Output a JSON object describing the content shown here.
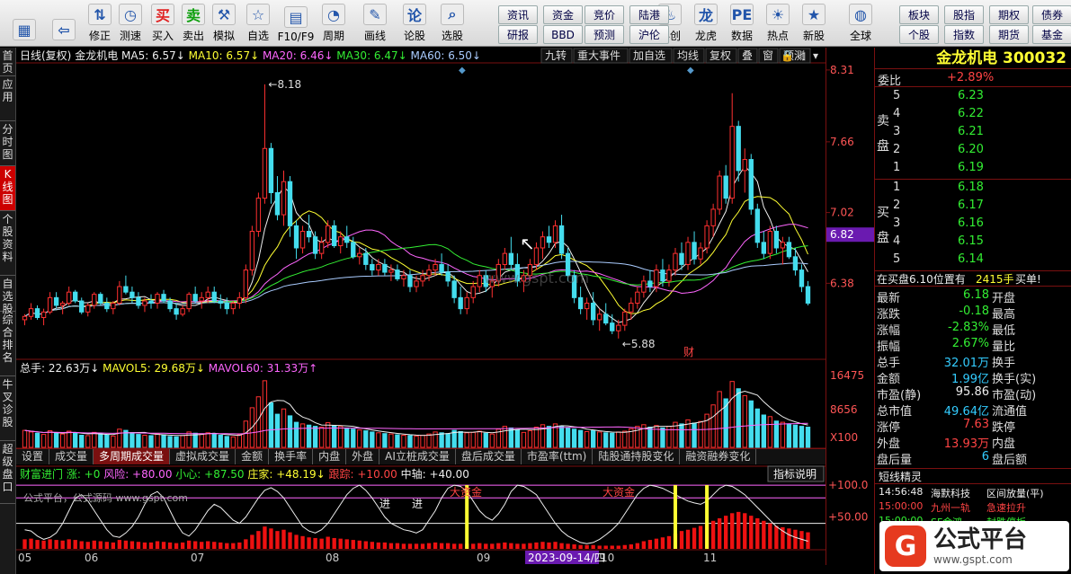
{
  "toolbar": {
    "buttons": [
      {
        "label": "",
        "icon": "home-grid-icon"
      },
      {
        "label": "",
        "icon": "back-arrow-icon"
      },
      {
        "label": "修正",
        "icon": "updown-arrow-icon"
      },
      {
        "label": "测速",
        "icon": "clock-icon"
      },
      {
        "label": "买入",
        "icon": "buy-icon",
        "glyph": "买"
      },
      {
        "label": "卖出",
        "icon": "sell-icon",
        "glyph": "卖"
      },
      {
        "label": "模拟",
        "icon": "gavel-icon"
      },
      {
        "label": "自选",
        "icon": "star-folder-icon"
      },
      {
        "label": "F10/F9",
        "icon": "f10-icon"
      },
      {
        "label": "周期",
        "icon": "period-icon"
      },
      {
        "label": "画线",
        "icon": "pencil-icon"
      },
      {
        "label": "论股",
        "icon": "discuss-icon"
      },
      {
        "label": "选股",
        "icon": "select-stock-icon"
      },
      {
        "label": "科创",
        "icon": "kechuang-icon"
      },
      {
        "label": "龙虎",
        "icon": "dragon-tiger-icon"
      },
      {
        "label": "数据",
        "icon": "pe-data-icon"
      },
      {
        "label": "热点",
        "icon": "hotspot-icon"
      },
      {
        "label": "新股",
        "icon": "new-stock-icon"
      },
      {
        "label": "全球",
        "icon": "globe-icon"
      }
    ],
    "small_buttons": [
      "资讯",
      "资金",
      "竞价",
      "陆港",
      "研报",
      "BBD",
      "预测",
      "沪伦",
      "板块",
      "股指",
      "期权",
      "债券",
      "个股",
      "指数",
      "期货",
      "基金"
    ]
  },
  "sidebar": [
    "首页",
    "应用",
    "分时图",
    "K线图",
    "个股资料",
    "自选股",
    "综合排名",
    "牛叉诊股",
    "超级盘口"
  ],
  "chart_header": {
    "period": "日线(复权)",
    "name": "金龙机电",
    "ma": [
      {
        "t": "MA5: 6.57↓",
        "c": "#eeeeee"
      },
      {
        "t": "MA10: 6.57↓",
        "c": "#ffff33"
      },
      {
        "t": "MA20: 6.46↓",
        "c": "#ff66ff"
      },
      {
        "t": "MA30: 6.47↓",
        "c": "#33ee33"
      },
      {
        "t": "MA60: 6.50↓",
        "c": "#aaccff"
      }
    ],
    "menu": [
      "九转",
      "重大事件",
      "加自选",
      "均线",
      "复权",
      "叠",
      "窗",
      "预测"
    ]
  },
  "price_axis": [
    "8.31",
    "7.66",
    "7.02",
    "6.38"
  ],
  "current_price_tag": "6.82",
  "annotations": {
    "high": "8.18",
    "low": "5.88",
    "fin": "财"
  },
  "volume_header": [
    {
      "t": "总手: 22.63万↓",
      "c": "#eeeeee"
    },
    {
      "t": "MAVOL5: 29.68万↓",
      "c": "#ffff33"
    },
    {
      "t": "MAVOL60: 31.33万↑",
      "c": "#ff66ff"
    }
  ],
  "volume_axis": [
    "16475",
    "8656",
    "X100"
  ],
  "subtabs": [
    "设置",
    "成交量",
    "多周期成交量",
    "虚拟成交量",
    "金额",
    "换手率",
    "内盘",
    "外盘",
    "AI立桩成交量",
    "盘后成交量",
    "市盈率(ttm)",
    "陆股通持股变化",
    "融资融券变化"
  ],
  "subtab_active": 2,
  "indicator_header": [
    {
      "t": "财富进门 涨: +0",
      "c": "#33ee33"
    },
    {
      "t": "风险: +80.00",
      "c": "#ff66ff"
    },
    {
      "t": "小心: +87.50",
      "c": "#33ee33"
    },
    {
      "t": "庄家: +48.19↓",
      "c": "#ffff33"
    },
    {
      "t": "跟踪: +10.00",
      "c": "#ff4444"
    },
    {
      "t": "中轴: +40.00",
      "c": "#eeeeee"
    }
  ],
  "indicator_button": "指标说明",
  "indicator_axis": [
    "+100.0",
    "+50.00"
  ],
  "indicator_text": {
    "t1": "公式平台，公式源码 www.gspt.com",
    "t2": "进",
    "t3": "进",
    "t4": "大资金",
    "t5": "大资金"
  },
  "date_axis": [
    "05",
    "06",
    "07",
    "08",
    "09",
    "10",
    "11"
  ],
  "date_highlight": "2023-09-14/四",
  "watermark": "www.gspt.com",
  "quote": {
    "title": "金龙机电 300032",
    "weibi_label": "委比",
    "weibi": "+2.89%",
    "sell_label": "卖盘",
    "buy_label": "买盘",
    "sell": [
      {
        "n": "5",
        "p": "6.23"
      },
      {
        "n": "4",
        "p": "6.22"
      },
      {
        "n": "3",
        "p": "6.21"
      },
      {
        "n": "2",
        "p": "6.20"
      },
      {
        "n": "1",
        "p": "6.19"
      }
    ],
    "buy": [
      {
        "n": "1",
        "p": "6.18"
      },
      {
        "n": "2",
        "p": "6.17"
      },
      {
        "n": "3",
        "p": "6.16"
      },
      {
        "n": "4",
        "p": "6.15"
      },
      {
        "n": "5",
        "p": "6.14"
      }
    ],
    "notice": "在买盘6.10位置有",
    "notice_vol": "2415手",
    "notice_tail": "买单!",
    "stats": [
      {
        "l": "最新",
        "v": "6.18",
        "vc": "#33ee33",
        "l2": "开盘"
      },
      {
        "l": "涨跌",
        "v": "-0.18",
        "vc": "#33ee33",
        "l2": "最高"
      },
      {
        "l": "涨幅",
        "v": "-2.83%",
        "vc": "#33ee33",
        "l2": "最低"
      },
      {
        "l": "振幅",
        "v": "2.67%",
        "vc": "#33ee33",
        "l2": "量比"
      },
      {
        "l": "总手",
        "v": "32.01万",
        "vc": "#33ccff",
        "l2": "换手"
      },
      {
        "l": "金额",
        "v": "1.99亿",
        "vc": "#33ccff",
        "l2": "换手(实)"
      },
      {
        "l": "市盈(静)",
        "v": "95.86",
        "vc": "#eeeeee",
        "l2": "市盈(动)"
      },
      {
        "l": "总市值",
        "v": "49.64亿",
        "vc": "#33ccff",
        "l2": "流通值"
      },
      {
        "l": "涨停",
        "v": "7.63",
        "vc": "#ff4444",
        "l2": "跌停"
      },
      {
        "l": "外盘",
        "v": "13.93万",
        "vc": "#ff4444",
        "l2": "内盘"
      },
      {
        "l": "盘后量",
        "v": "6",
        "vc": "#33ccff",
        "l2": "盘后额"
      }
    ],
    "news_title": "短线精灵",
    "news": [
      {
        "t": "14:56:48",
        "n": "海默科技",
        "e": "区间放量(平)",
        "tc": "#eeeeee",
        "nc": "#eeeeee",
        "ec": "#eeeeee"
      },
      {
        "t": "15:00:00",
        "n": "九州一轨",
        "e": "急速拉升",
        "tc": "#ff4444",
        "nc": "#ff4444",
        "ec": "#ff4444"
      },
      {
        "t": "15:00:00",
        "n": "SF金鸿",
        "e": "封跌停板",
        "tc": "#33ee33",
        "nc": "#33ee33",
        "ec": "#33ee33"
      }
    ]
  },
  "logo": {
    "text": "公式平台",
    "url": "www.gspt.com"
  },
  "chart_data": {
    "type": "candlestick",
    "price_range": [
      5.7,
      8.35
    ],
    "candles": [
      [
        6.05,
        6.1,
        6.0,
        6.08
      ],
      [
        6.08,
        6.2,
        6.05,
        6.15
      ],
      [
        6.15,
        6.18,
        6.05,
        6.07
      ],
      [
        6.07,
        6.15,
        6.0,
        6.12
      ],
      [
        6.12,
        6.3,
        6.1,
        6.25
      ],
      [
        6.25,
        6.3,
        6.15,
        6.18
      ],
      [
        6.18,
        6.22,
        6.1,
        6.2
      ],
      [
        6.2,
        6.35,
        6.18,
        6.3
      ],
      [
        6.3,
        6.32,
        6.2,
        6.22
      ],
      [
        6.22,
        6.25,
        6.1,
        6.12
      ],
      [
        6.12,
        6.2,
        6.08,
        6.18
      ],
      [
        6.18,
        6.3,
        6.15,
        6.28
      ],
      [
        6.28,
        6.3,
        6.18,
        6.2
      ],
      [
        6.2,
        6.25,
        6.12,
        6.15
      ],
      [
        6.15,
        6.22,
        6.1,
        6.2
      ],
      [
        6.2,
        6.4,
        6.18,
        6.35
      ],
      [
        6.35,
        6.45,
        6.28,
        6.3
      ],
      [
        6.3,
        6.35,
        6.2,
        6.25
      ],
      [
        6.25,
        6.3,
        6.15,
        6.18
      ],
      [
        6.18,
        6.25,
        6.12,
        6.22
      ],
      [
        6.22,
        6.28,
        6.15,
        6.2
      ],
      [
        6.2,
        6.3,
        6.15,
        6.28
      ],
      [
        6.28,
        6.32,
        6.2,
        6.22
      ],
      [
        6.22,
        6.25,
        6.12,
        6.15
      ],
      [
        6.15,
        6.2,
        6.05,
        6.1
      ],
      [
        6.1,
        6.18,
        6.08,
        6.15
      ],
      [
        6.15,
        6.3,
        6.12,
        6.28
      ],
      [
        6.28,
        6.35,
        6.2,
        6.22
      ],
      [
        6.22,
        6.3,
        6.15,
        6.25
      ],
      [
        6.25,
        6.35,
        6.2,
        6.3
      ],
      [
        6.3,
        6.35,
        6.2,
        6.22
      ],
      [
        6.22,
        6.28,
        6.15,
        6.2
      ],
      [
        6.2,
        6.25,
        6.1,
        6.15
      ],
      [
        6.15,
        6.22,
        6.1,
        6.2
      ],
      [
        6.2,
        6.3,
        6.15,
        6.25
      ],
      [
        6.25,
        6.55,
        6.2,
        6.5
      ],
      [
        6.5,
        6.9,
        6.45,
        6.85
      ],
      [
        6.85,
        7.2,
        6.8,
        7.15
      ],
      [
        7.15,
        8.18,
        7.1,
        7.6
      ],
      [
        7.6,
        7.65,
        7.1,
        7.2
      ],
      [
        7.2,
        7.35,
        6.95,
        7.0
      ],
      [
        7.0,
        7.4,
        6.9,
        7.3
      ],
      [
        7.3,
        7.35,
        6.8,
        6.9
      ],
      [
        6.9,
        6.95,
        6.6,
        6.7
      ],
      [
        6.7,
        6.9,
        6.65,
        6.85
      ],
      [
        6.85,
        7.0,
        6.75,
        6.8
      ],
      [
        6.8,
        6.85,
        6.6,
        6.65
      ],
      [
        6.65,
        6.8,
        6.6,
        6.75
      ],
      [
        6.75,
        6.95,
        6.7,
        6.9
      ],
      [
        6.9,
        6.95,
        6.7,
        6.72
      ],
      [
        6.72,
        6.85,
        6.65,
        6.8
      ],
      [
        6.8,
        6.9,
        6.7,
        6.75
      ],
      [
        6.75,
        6.8,
        6.6,
        6.62
      ],
      [
        6.62,
        6.7,
        6.55,
        6.65
      ],
      [
        6.65,
        6.7,
        6.5,
        6.55
      ],
      [
        6.55,
        6.6,
        6.45,
        6.5
      ],
      [
        6.5,
        6.6,
        6.45,
        6.55
      ],
      [
        6.55,
        6.6,
        6.45,
        6.48
      ],
      [
        6.48,
        6.55,
        6.4,
        6.5
      ],
      [
        6.5,
        6.55,
        6.4,
        6.42
      ],
      [
        6.42,
        6.5,
        6.35,
        6.45
      ],
      [
        6.45,
        6.5,
        6.3,
        6.35
      ],
      [
        6.35,
        6.45,
        6.3,
        6.4
      ],
      [
        6.4,
        6.5,
        6.35,
        6.45
      ],
      [
        6.45,
        6.55,
        6.4,
        6.5
      ],
      [
        6.5,
        6.6,
        6.45,
        6.55
      ],
      [
        6.55,
        6.65,
        6.45,
        6.48
      ],
      [
        6.48,
        6.55,
        6.35,
        6.4
      ],
      [
        6.4,
        6.45,
        6.2,
        6.25
      ],
      [
        6.25,
        6.35,
        6.1,
        6.15
      ],
      [
        6.15,
        6.3,
        6.1,
        6.25
      ],
      [
        6.25,
        6.4,
        6.2,
        6.35
      ],
      [
        6.35,
        6.5,
        6.3,
        6.45
      ],
      [
        6.45,
        6.5,
        6.3,
        6.35
      ],
      [
        6.35,
        6.45,
        6.25,
        6.4
      ],
      [
        6.4,
        6.6,
        6.35,
        6.55
      ],
      [
        6.55,
        6.7,
        6.5,
        6.65
      ],
      [
        6.65,
        6.8,
        6.5,
        6.55
      ],
      [
        6.55,
        6.65,
        6.35,
        6.4
      ],
      [
        6.4,
        6.5,
        6.3,
        6.45
      ],
      [
        6.45,
        6.6,
        6.4,
        6.55
      ],
      [
        6.55,
        6.75,
        6.5,
        6.7
      ],
      [
        6.7,
        6.85,
        6.6,
        6.8
      ],
      [
        6.8,
        6.9,
        6.7,
        6.75
      ],
      [
        6.75,
        6.95,
        6.7,
        6.9
      ],
      [
        6.9,
        7.0,
        6.6,
        6.65
      ],
      [
        6.65,
        6.7,
        6.4,
        6.45
      ],
      [
        6.45,
        6.5,
        6.2,
        6.25
      ],
      [
        6.25,
        6.35,
        6.1,
        6.15
      ],
      [
        6.15,
        6.25,
        6.05,
        6.2
      ],
      [
        6.2,
        6.3,
        6.0,
        6.05
      ],
      [
        6.05,
        6.15,
        5.95,
        6.1
      ],
      [
        6.1,
        6.2,
        6.0,
        6.02
      ],
      [
        6.02,
        6.1,
        5.92,
        5.95
      ],
      [
        5.95,
        6.05,
        5.88,
        6.0
      ],
      [
        6.0,
        6.15,
        5.95,
        6.12
      ],
      [
        6.12,
        6.25,
        6.05,
        6.2
      ],
      [
        6.2,
        6.35,
        6.15,
        6.3
      ],
      [
        6.3,
        6.45,
        6.25,
        6.4
      ],
      [
        6.4,
        6.5,
        6.3,
        6.35
      ],
      [
        6.35,
        6.55,
        6.3,
        6.5
      ],
      [
        6.5,
        6.6,
        6.35,
        6.4
      ],
      [
        6.4,
        6.55,
        6.35,
        6.5
      ],
      [
        6.5,
        6.7,
        6.45,
        6.65
      ],
      [
        6.65,
        6.75,
        6.5,
        6.55
      ],
      [
        6.55,
        6.8,
        6.5,
        6.75
      ],
      [
        6.75,
        6.85,
        6.55,
        6.6
      ],
      [
        6.6,
        6.75,
        6.55,
        6.7
      ],
      [
        6.7,
        6.95,
        6.65,
        6.9
      ],
      [
        6.9,
        7.1,
        6.8,
        7.05
      ],
      [
        7.05,
        7.4,
        7.0,
        7.35
      ],
      [
        7.35,
        7.45,
        7.1,
        7.15
      ],
      [
        7.15,
        8.1,
        7.1,
        7.8
      ],
      [
        7.8,
        7.85,
        7.3,
        7.4
      ],
      [
        7.4,
        7.6,
        7.2,
        7.5
      ],
      [
        7.5,
        7.55,
        7.0,
        7.05
      ],
      [
        7.05,
        7.1,
        6.7,
        6.75
      ],
      [
        6.75,
        6.85,
        6.6,
        6.65
      ],
      [
        6.65,
        6.9,
        6.6,
        6.85
      ],
      [
        6.85,
        6.9,
        6.65,
        6.7
      ],
      [
        6.7,
        6.8,
        6.55,
        6.75
      ],
      [
        6.75,
        6.8,
        6.6,
        6.62
      ],
      [
        6.62,
        6.7,
        6.45,
        6.5
      ],
      [
        6.5,
        6.55,
        6.3,
        6.35
      ],
      [
        6.35,
        6.4,
        6.18,
        6.2
      ]
    ],
    "volume_range": [
      0,
      18000
    ],
    "volumes": [
      4200,
      3800,
      3500,
      3200,
      4100,
      3600,
      3300,
      4000,
      3500,
      3000,
      2900,
      3700,
      3400,
      3100,
      2800,
      4500,
      4200,
      3600,
      3200,
      3000,
      2900,
      3400,
      3100,
      2700,
      2600,
      2900,
      3800,
      3500,
      3200,
      3600,
      3300,
      3000,
      2700,
      2600,
      3100,
      6500,
      9800,
      12500,
      16475,
      11000,
      8200,
      9500,
      7800,
      6200,
      5800,
      5500,
      5200,
      5000,
      6100,
      5400,
      5200,
      4800,
      4500,
      4300,
      4100,
      3800,
      3600,
      3400,
      3300,
      3100,
      3000,
      2900,
      2800,
      3000,
      3300,
      3800,
      3600,
      3400,
      4200,
      3900,
      3600,
      3700,
      4000,
      3500,
      3300,
      4500,
      5200,
      4800,
      4300,
      3700,
      4100,
      5000,
      5600,
      5200,
      5800,
      5200,
      4800,
      4500,
      4200,
      3900,
      4100,
      3800,
      3600,
      3500,
      3800,
      4000,
      4600,
      5200,
      5600,
      5000,
      5400,
      4800,
      5200,
      6200,
      5800,
      6800,
      6000,
      6400,
      8200,
      10500,
      13800,
      12000,
      16300,
      14500,
      12800,
      11500,
      9500,
      8000,
      7600,
      6500,
      6200,
      5800,
      5500,
      5200,
      5000
    ],
    "ma_colors": {
      "ma5": "#eeeeee",
      "ma10": "#ffff33",
      "ma20": "#ff66ff",
      "ma30": "#33ee33",
      "ma60": "#aaccff"
    },
    "indicator_range": [
      0,
      110
    ],
    "indicator_bars": [
      15,
      16,
      14,
      13,
      15,
      14,
      13,
      15,
      14,
      12,
      11,
      13,
      12,
      11,
      10,
      14,
      13,
      12,
      11,
      10,
      10,
      12,
      11,
      10,
      9,
      10,
      13,
      12,
      11,
      12,
      11,
      10,
      9,
      9,
      10,
      15,
      22,
      28,
      35,
      32,
      28,
      30,
      26,
      22,
      20,
      18,
      17,
      16,
      19,
      17,
      16,
      15,
      14,
      13,
      12,
      11,
      10,
      10,
      9,
      9,
      8,
      8,
      8,
      8,
      9,
      10,
      9,
      9,
      8,
      8,
      8,
      8,
      9,
      8,
      8,
      9,
      10,
      9,
      8,
      8,
      9,
      10,
      11,
      10,
      11,
      9,
      8,
      7,
      6,
      6,
      6,
      5,
      5,
      5,
      5,
      6,
      7,
      9,
      12,
      14,
      16,
      18,
      20,
      24,
      28,
      30,
      33,
      36,
      40,
      44,
      48,
      52,
      56,
      58,
      56,
      52,
      48,
      44,
      40,
      36,
      34,
      32,
      30,
      28,
      26
    ],
    "indicator_line": [
      30,
      28,
      20,
      15,
      18,
      25,
      40,
      60,
      80,
      85,
      75,
      60,
      45,
      30,
      20,
      18,
      25,
      35,
      50,
      70,
      85,
      90,
      80,
      60,
      40,
      25,
      20,
      30,
      45,
      60,
      70,
      65,
      55,
      45,
      40,
      50,
      65,
      80,
      92,
      96,
      90,
      80,
      65,
      50,
      35,
      28,
      25,
      30,
      40,
      55,
      70,
      85,
      95,
      100,
      92,
      80,
      65,
      50,
      40,
      35,
      30,
      28,
      25,
      30,
      45,
      60,
      80,
      95,
      100,
      98,
      90,
      75,
      60,
      50,
      45,
      55,
      70,
      90,
      100,
      98,
      92,
      85,
      70,
      55,
      40,
      28,
      20,
      15,
      10,
      8,
      10,
      15,
      22,
      30,
      40,
      55,
      70,
      85,
      95,
      100,
      98,
      95,
      90,
      85,
      80,
      75,
      72,
      70,
      75,
      85,
      95,
      100,
      98,
      92,
      85,
      75,
      65,
      55,
      45,
      35,
      28,
      22,
      18,
      15,
      12
    ]
  }
}
